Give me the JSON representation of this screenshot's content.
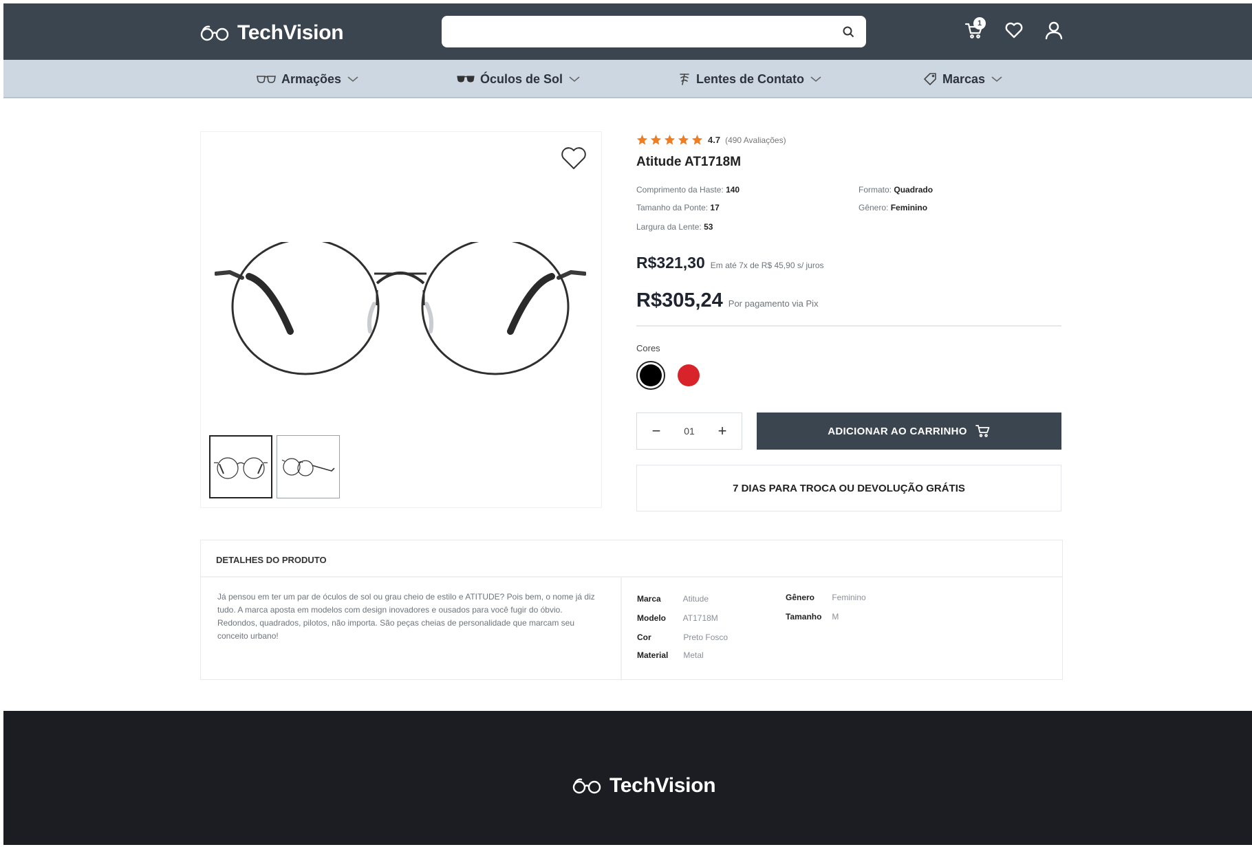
{
  "brand": {
    "name": "TechVision",
    "icon": "glasses-icon"
  },
  "search": {
    "placeholder": ""
  },
  "header": {
    "cart_count": "1",
    "icons": [
      "cart-icon",
      "heart-icon",
      "user-icon"
    ]
  },
  "nav": {
    "items": [
      {
        "label": "Armações",
        "icon": "eyeglasses-outline-icon"
      },
      {
        "label": "Óculos de Sol",
        "icon": "sunglasses-icon"
      },
      {
        "label": "Lentes de Contato",
        "icon": "contact-lens-icon"
      },
      {
        "label": "Marcas",
        "icon": "tag-icon"
      }
    ]
  },
  "product": {
    "rating": {
      "score": "4.7",
      "count_text": "(490 Avaliações)",
      "stars": 5,
      "star_color": "#ef7d22"
    },
    "title": "Atitude AT1718M",
    "specs": {
      "temple_length": {
        "label": "Comprimento da Haste:",
        "value": "140"
      },
      "bridge_size": {
        "label": "Tamanho da Ponte:",
        "value": "17"
      },
      "lens_width": {
        "label": "Largura da Lente:",
        "value": "53"
      },
      "shape": {
        "label": "Formato:",
        "value": "Quadrado"
      },
      "gender": {
        "label": "Gênero:",
        "value": "Feminino"
      }
    },
    "price": {
      "regular": "R$321,30",
      "installments": "Em até 7x de R$ 45,90 s/ juros",
      "pix": "R$305,24",
      "pix_note": "Por pagamento via Pix"
    },
    "colors": {
      "label": "Cores",
      "options": [
        {
          "name": "Preto",
          "hex": "#000000",
          "selected": true
        },
        {
          "name": "Vermelho",
          "hex": "#d9232b",
          "selected": false
        }
      ]
    },
    "quantity": {
      "value": "01",
      "minus": "−",
      "plus": "+"
    },
    "add_to_cart": "ADICIONAR AO CARRINHO",
    "return_policy": "7 DIAS PARA TROCA OU DEVOLUÇÃO GRÁTIS"
  },
  "details": {
    "heading": "DETALHES DO PRODUTO",
    "description": "Já pensou em ter um par de óculos de sol ou grau cheio de estilo e ATITUDE? Pois bem, o nome já diz tudo. A marca aposta em modelos com design inovadores e ousados para você fugir do óbvio. Redondos, quadrados, pilotos, não importa. São peças cheias de personalidade que marcam seu conceito urbano!",
    "attributes": {
      "brand": {
        "key": "Marca",
        "value": "Atitude"
      },
      "model": {
        "key": "Modelo",
        "value": "AT1718M"
      },
      "color": {
        "key": "Cor",
        "value": "Preto Fosco"
      },
      "material": {
        "key": "Material",
        "value": "Metal"
      },
      "gender": {
        "key": "Gênero",
        "value": "Feminino"
      },
      "size": {
        "key": "Tamanho",
        "value": "M"
      }
    }
  },
  "footer": {
    "brand": "TechVision"
  },
  "colors": {
    "header_bg": "#3b4550",
    "nav_bg": "#cdd7e1",
    "footer_bg": "#1c1d22",
    "accent": "#3b4550"
  }
}
